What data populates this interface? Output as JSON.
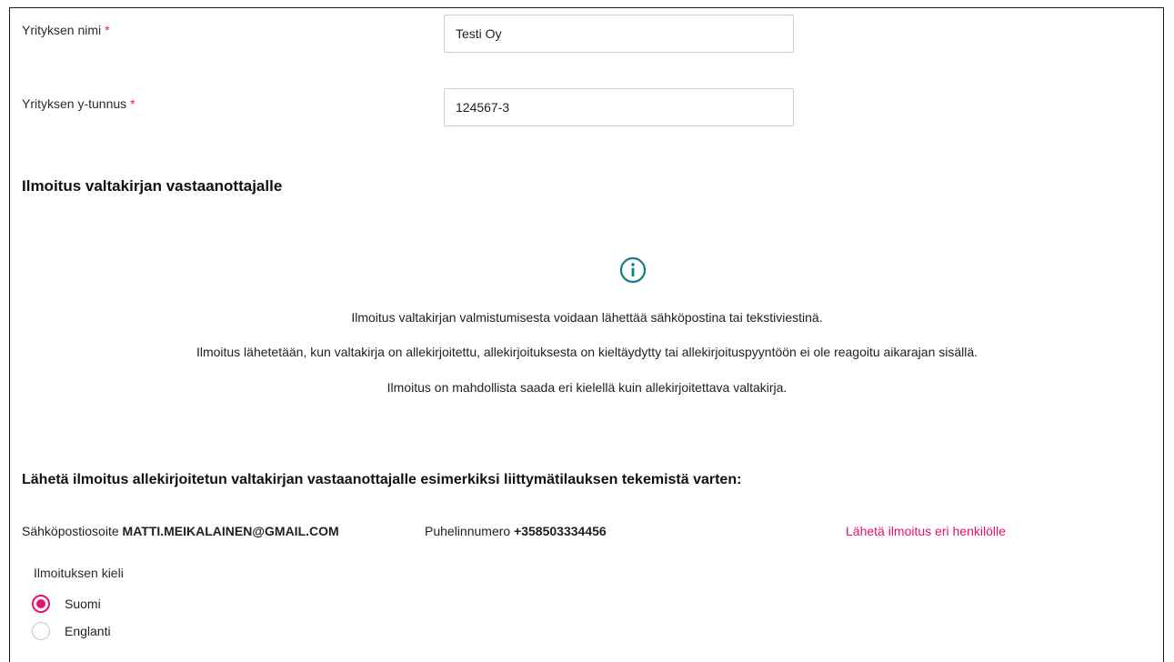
{
  "company": {
    "name_label": "Yrityksen nimi",
    "name_required": "*",
    "name_value": "Testi Oy",
    "id_label": "Yrityksen y-tunnus",
    "id_required": "*",
    "id_value": "124567-3"
  },
  "notice": {
    "heading": "Ilmoitus valtakirjan vastaanottajalle",
    "icon": "info-icon",
    "lines": [
      "Ilmoitus valtakirjan valmistumisesta voidaan lähettää sähköpostina tai tekstiviestinä.",
      "Ilmoitus lähetetään, kun valtakirja on allekirjoitettu, allekirjoituksesta on kieltäydytty tai allekirjoituspyyntöön ei ole reagoitu aikarajan sisällä.",
      "Ilmoitus on mahdollista saada eri kielellä kuin allekirjoitettava valtakirja."
    ]
  },
  "recipient": {
    "heading": "Lähetä ilmoitus allekirjoitetun valtakirjan vastaanottajalle esimerkiksi liittymätilauksen tekemistä varten:",
    "email_label": "Sähköpostiosoite",
    "email_value": "MATTI.MEIKALAINEN@GMAIL.COM",
    "phone_label": "Puhelinnumero",
    "phone_value": "+358503334456",
    "send_other_link": "Lähetä ilmoitus eri henkilölle"
  },
  "language": {
    "label": "Ilmoituksen kieli",
    "options": [
      {
        "label": "Suomi",
        "selected": true
      },
      {
        "label": "Englanti",
        "selected": false
      }
    ]
  },
  "colors": {
    "accent": "#e5116f",
    "info_icon": "#0f7f8c"
  }
}
